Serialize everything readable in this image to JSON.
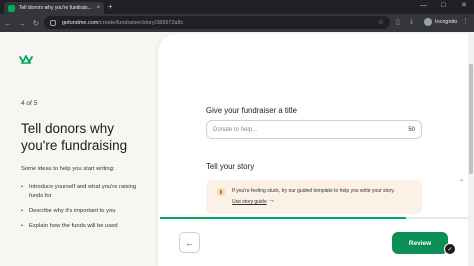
{
  "browser": {
    "tab_title": "Tell donors why you're fundrais...",
    "tab_close": "×",
    "new_tab": "+",
    "url_host": "gofundme.com",
    "url_path": "/create/fundraiser/story/389672a8c",
    "incognito_label": "Incognito",
    "window_controls": [
      "—",
      "□",
      "✕"
    ]
  },
  "sidebar": {
    "step": "4 of 5",
    "headline": "Tell donors why you're fundraising",
    "ideas_intro": "Some ideas to help you start writing:",
    "bullets": [
      "Introduce yourself and what you're raising funds for",
      "Describe why it's important to you",
      "Explain how the funds will be used"
    ]
  },
  "form": {
    "title_label": "Give your fundraiser a title",
    "title_placeholder": "Donate to help...",
    "title_char_count": "50",
    "story_label": "Tell your story",
    "tip_text": "If you're feeling stuck, try our guided template to help you write your story.",
    "tip_link": "Use story guide"
  },
  "footer": {
    "review_label": "Review",
    "back_icon": "arrow-left-icon"
  },
  "colors": {
    "brand_green": "#02a95c",
    "review_button": "#0c8f55",
    "tip_background": "#fbf1e6"
  }
}
